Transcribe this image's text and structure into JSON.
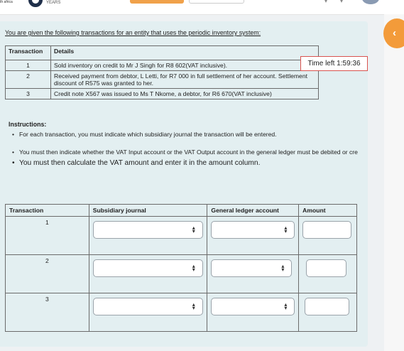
{
  "header": {
    "logo_small_text": "th africa",
    "logo_years": "YEARS"
  },
  "timer": {
    "label": "Time left 1:59:36"
  },
  "intro": "You are given the following transactions for an entity that uses the periodic inventory system:",
  "transactions_table": {
    "headers": [
      "Transaction",
      "Details"
    ],
    "rows": [
      {
        "num": "1",
        "details": "Sold inventory on credit to Mr J Singh for R8 602(VAT inclusive)."
      },
      {
        "num": "2",
        "details": "Received payment from debtor, L Letti, for R7 000 in full settlement of her account. Settlement discount of R575 was granted to her."
      },
      {
        "num": "3",
        "details": "Credit note X567 was issued to Ms T Nkome, a debtor, for R6 670(VAT inclusive)"
      }
    ]
  },
  "instructions": {
    "title": "Instructions:",
    "items": [
      "For each transaction, you must indicate which subsidiary journal the transaction will be entered.",
      "You must then indicate whether the VAT Input account or the VAT Output account in the general ledger must be debited or cre",
      "You must then calculate the VAT amount and enter it in the amount column."
    ]
  },
  "answer_table": {
    "headers": [
      "Transaction",
      "Subsidiary journal",
      "General ledger account",
      "Amount"
    ],
    "rows": [
      {
        "num": "1",
        "journal": "",
        "account": "",
        "amount": ""
      },
      {
        "num": "2",
        "journal": "",
        "account": "",
        "amount": ""
      },
      {
        "num": "3",
        "journal": "",
        "account": "",
        "amount": ""
      }
    ]
  },
  "colors": {
    "accent": "#f39b3a",
    "panel": "#e3eff1",
    "timer_border": "#d9534f"
  }
}
